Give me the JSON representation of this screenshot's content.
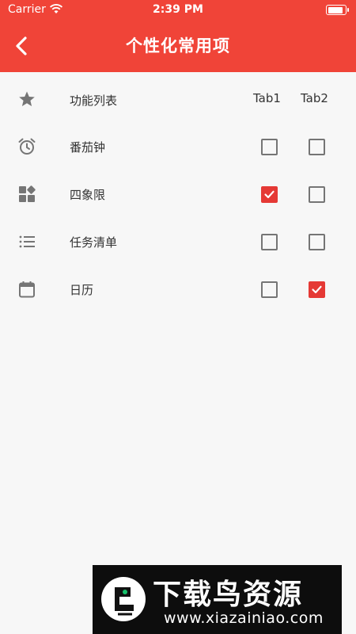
{
  "status_bar": {
    "carrier": "Carrier",
    "time": "2:39 PM",
    "battery_level": 0.9
  },
  "nav": {
    "title": "个性化常用项",
    "back_icon": "chevron-left-icon"
  },
  "table": {
    "header_label": "功能列表",
    "header_icon": "star-icon",
    "columns": [
      "Tab1",
      "Tab2"
    ],
    "rows": [
      {
        "label": "番茄钟",
        "icon": "alarm-clock-icon",
        "tab1": false,
        "tab2": false
      },
      {
        "label": "四象限",
        "icon": "widgets-icon",
        "tab1": true,
        "tab2": false
      },
      {
        "label": "任务清单",
        "icon": "list-icon",
        "tab1": false,
        "tab2": false
      },
      {
        "label": "日历",
        "icon": "calendar-icon",
        "tab1": false,
        "tab2": true
      }
    ]
  },
  "colors": {
    "accent": "#f04438",
    "checkbox_checked": "#e53935",
    "icon_gray": "#757575"
  },
  "watermark": {
    "title": "下载鸟资源",
    "url": "www.xiazainiao.com"
  }
}
